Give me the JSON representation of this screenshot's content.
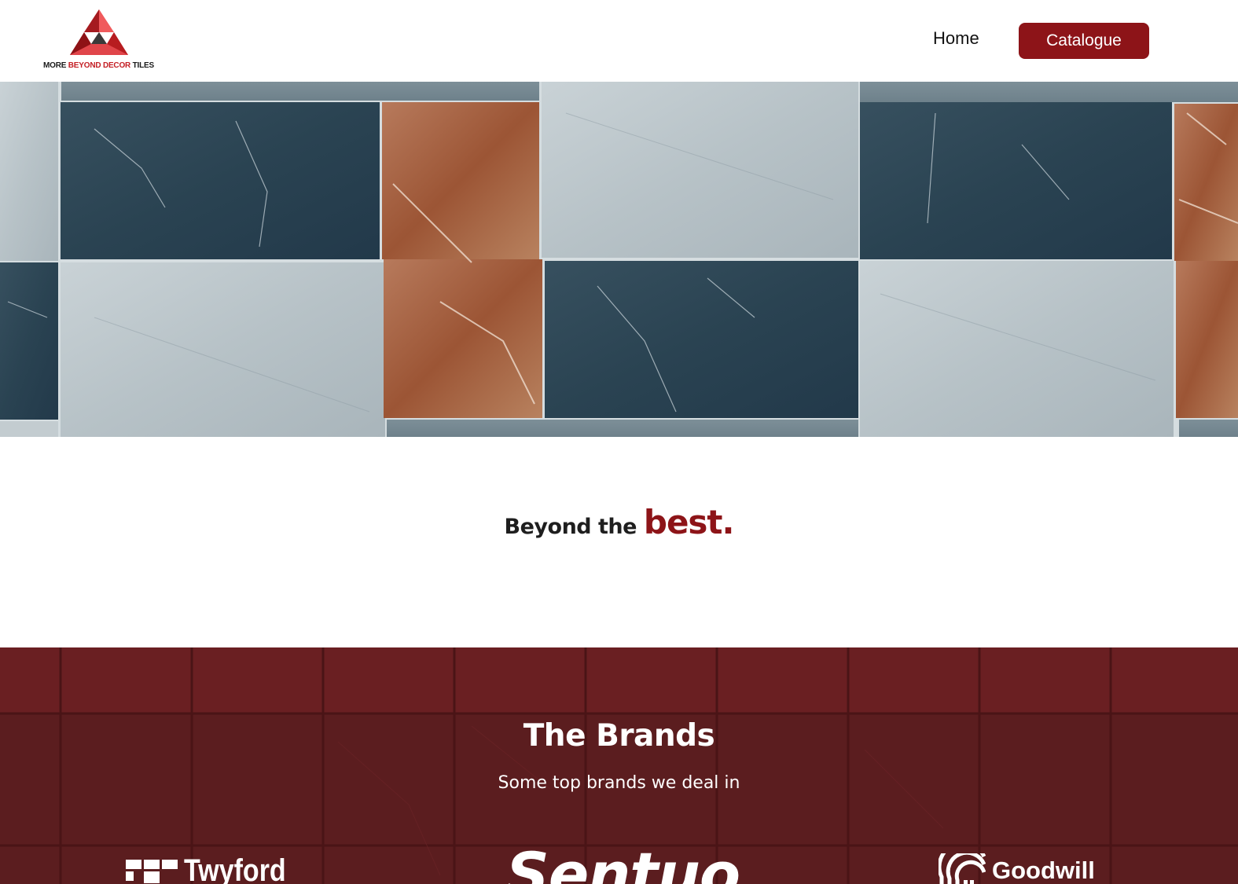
{
  "header": {
    "logo": {
      "text_dark_1": "MORE ",
      "text_red": "BEYOND DECOR ",
      "text_dark_2": "TILES"
    },
    "nav": {
      "home_label": "Home",
      "catalogue_label": "Catalogue"
    }
  },
  "tagline": {
    "lead": "Beyond the ",
    "accent": "best."
  },
  "brands": {
    "title": "The Brands",
    "subtitle": "Some top brands we deal in",
    "items": [
      {
        "name": "Twyford"
      },
      {
        "name": "Sentuo"
      },
      {
        "name": "Goodwill"
      }
    ]
  },
  "colors": {
    "brand_red": "#8d1418",
    "brands_bg": "#5b1d1f",
    "logo_red": "#c41e24"
  }
}
